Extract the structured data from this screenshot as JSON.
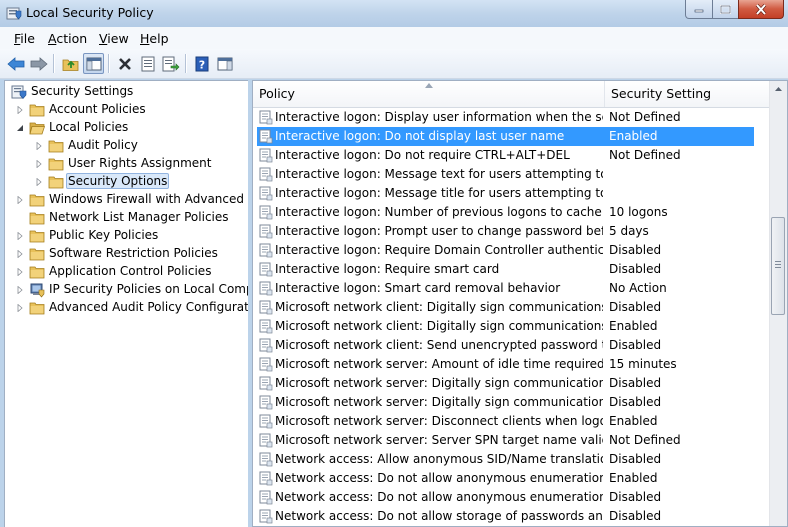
{
  "window": {
    "title": "Local Security Policy"
  },
  "menu": [
    {
      "label": "File",
      "accel": "F",
      "rest": "ile"
    },
    {
      "label": "Action",
      "accel": "A",
      "rest": "ction"
    },
    {
      "label": "View",
      "accel": "V",
      "rest": "iew"
    },
    {
      "label": "Help",
      "accel": "H",
      "rest": "elp"
    }
  ],
  "toolbar": [
    "back-icon",
    "forward-icon",
    "up-folder-icon",
    "show-hide-tree-icon",
    "delete-icon",
    "properties-icon",
    "export-list-icon",
    "help-icon",
    "console-tree-icon"
  ],
  "tree": [
    {
      "label": "Security Settings",
      "level": 0,
      "arrow": "none",
      "icon": "security-settings-icon"
    },
    {
      "label": "Account Policies",
      "level": 1,
      "arrow": "collapsed",
      "icon": "folder-icon"
    },
    {
      "label": "Local Policies",
      "level": 1,
      "arrow": "expanded",
      "icon": "folder-open-icon"
    },
    {
      "label": "Audit Policy",
      "level": 2,
      "arrow": "collapsed",
      "icon": "folder-icon"
    },
    {
      "label": "User Rights Assignment",
      "level": 2,
      "arrow": "collapsed",
      "icon": "folder-icon"
    },
    {
      "label": "Security Options",
      "level": 2,
      "arrow": "collapsed",
      "icon": "folder-icon",
      "selected": true
    },
    {
      "label": "Windows Firewall with Advanced Security",
      "level": 1,
      "arrow": "collapsed",
      "icon": "folder-icon"
    },
    {
      "label": "Network List Manager Policies",
      "level": 1,
      "arrow": "none",
      "icon": "folder-icon"
    },
    {
      "label": "Public Key Policies",
      "level": 1,
      "arrow": "collapsed",
      "icon": "folder-icon"
    },
    {
      "label": "Software Restriction Policies",
      "level": 1,
      "arrow": "collapsed",
      "icon": "folder-icon"
    },
    {
      "label": "Application Control Policies",
      "level": 1,
      "arrow": "collapsed",
      "icon": "folder-icon"
    },
    {
      "label": "IP Security Policies on Local Computer",
      "level": 1,
      "arrow": "collapsed",
      "icon": "ip-security-icon"
    },
    {
      "label": "Advanced Audit Policy Configuration",
      "level": 1,
      "arrow": "collapsed",
      "icon": "folder-icon"
    }
  ],
  "list": {
    "columns": {
      "policy": "Policy",
      "setting": "Security Setting"
    },
    "rows": [
      {
        "policy": "Interactive logon: Display user information when the session...",
        "setting": "Not Defined"
      },
      {
        "policy": "Interactive logon: Do not display last user name",
        "setting": "Enabled",
        "selected": true
      },
      {
        "policy": "Interactive logon: Do not require CTRL+ALT+DEL",
        "setting": "Not Defined"
      },
      {
        "policy": "Interactive logon: Message text for users attempting to log on",
        "setting": ""
      },
      {
        "policy": "Interactive logon: Message title for users attempting to log on",
        "setting": ""
      },
      {
        "policy": "Interactive logon: Number of previous logons to cache (in c...",
        "setting": "10 logons"
      },
      {
        "policy": "Interactive logon: Prompt user to change password before e...",
        "setting": "5 days"
      },
      {
        "policy": "Interactive logon: Require Domain Controller authentication...",
        "setting": "Disabled"
      },
      {
        "policy": "Interactive logon: Require smart card",
        "setting": "Disabled"
      },
      {
        "policy": "Interactive logon: Smart card removal behavior",
        "setting": "No Action"
      },
      {
        "policy": "Microsoft network client: Digitally sign communications (al...",
        "setting": "Disabled"
      },
      {
        "policy": "Microsoft network client: Digitally sign communications (if ...",
        "setting": "Enabled"
      },
      {
        "policy": "Microsoft network client: Send unencrypted password to thi...",
        "setting": "Disabled"
      },
      {
        "policy": "Microsoft network server: Amount of idle time required bef...",
        "setting": "15 minutes"
      },
      {
        "policy": "Microsoft network server: Digitally sign communications (al...",
        "setting": "Disabled"
      },
      {
        "policy": "Microsoft network server: Digitally sign communications (if ...",
        "setting": "Disabled"
      },
      {
        "policy": "Microsoft network server: Disconnect clients when logon ho...",
        "setting": "Enabled"
      },
      {
        "policy": "Microsoft network server: Server SPN target name validation...",
        "setting": "Not Defined"
      },
      {
        "policy": "Network access: Allow anonymous SID/Name translation",
        "setting": "Disabled"
      },
      {
        "policy": "Network access: Do not allow anonymous enumeration of S...",
        "setting": "Enabled"
      },
      {
        "policy": "Network access: Do not allow anonymous enumeration of S...",
        "setting": "Disabled"
      },
      {
        "policy": "Network access: Do not allow storage of passwords and cre...",
        "setting": "Disabled"
      }
    ]
  },
  "colors": {
    "selection": "#3399ff",
    "frame": "#bcd3ea",
    "folder": "#e8c15a"
  }
}
